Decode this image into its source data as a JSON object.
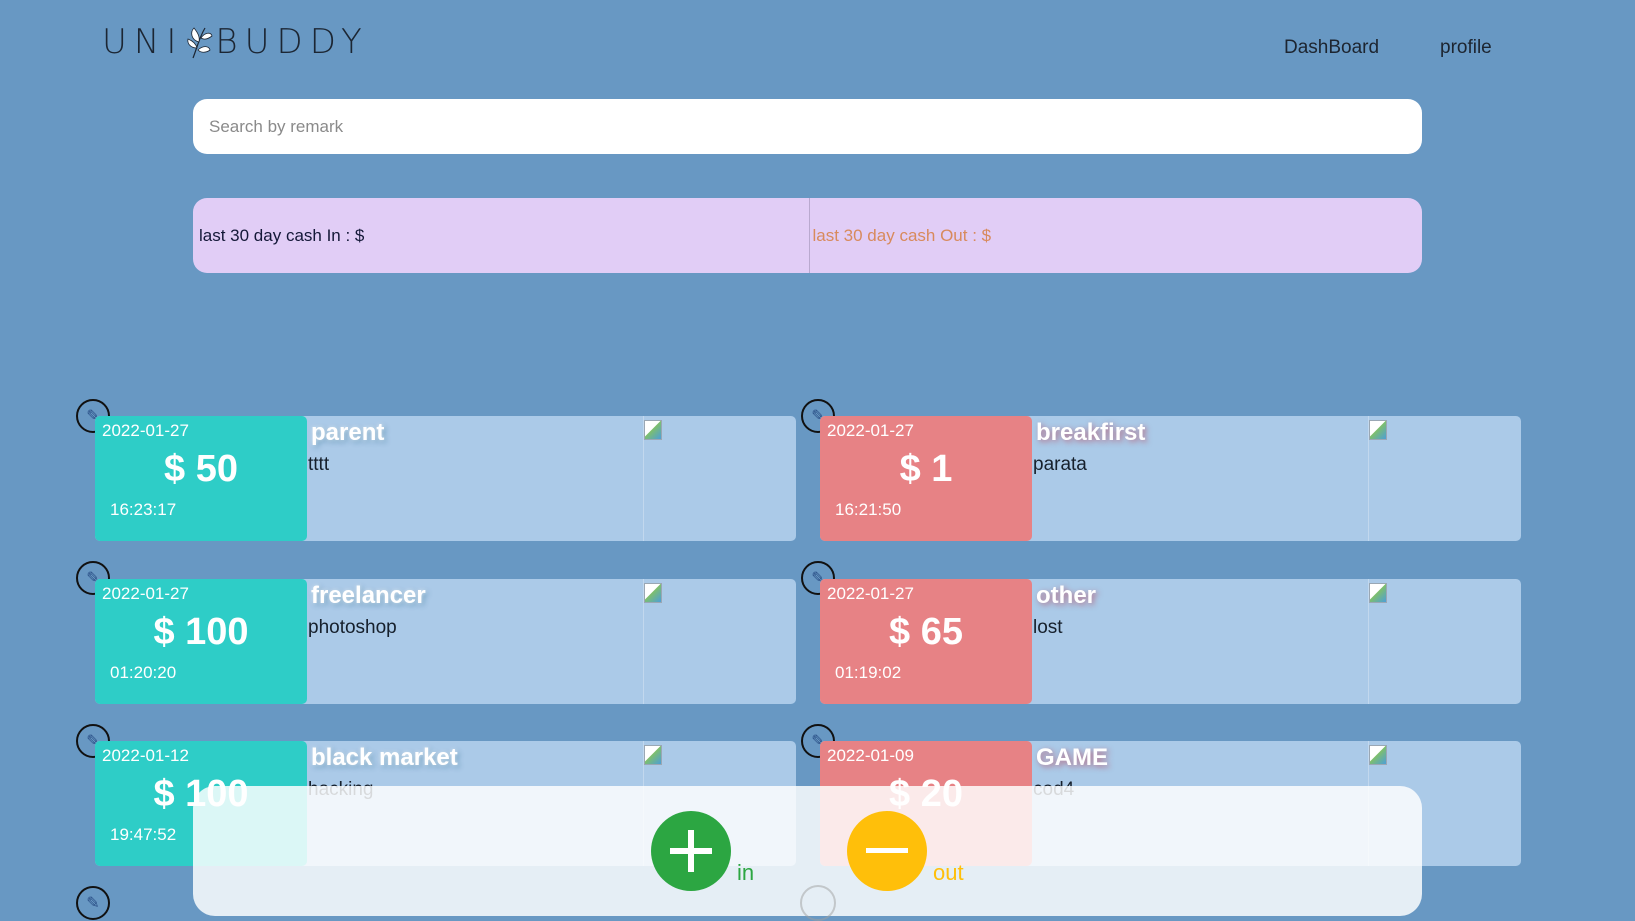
{
  "brand": {
    "left": "UNI",
    "right": "BUDDY"
  },
  "nav": {
    "dashboard": "DashBoard",
    "profile": "profile"
  },
  "search": {
    "placeholder": "Search by remark",
    "value": ""
  },
  "summary": {
    "cash_in_label": "last 30 day cash In : $",
    "cash_out_label": "last 30 day cash Out : $"
  },
  "entries": [
    {
      "type": "in",
      "date": "2022-01-27",
      "amount": "$ 50",
      "time": "16:23:17",
      "category": "parent",
      "remark": "tttt"
    },
    {
      "type": "out",
      "date": "2022-01-27",
      "amount": "$ 1",
      "time": "16:21:50",
      "category": "breakfirst",
      "remark": "parata"
    },
    {
      "type": "in",
      "date": "2022-01-27",
      "amount": "$ 100",
      "time": "01:20:20",
      "category": "freelancer",
      "remark": "photoshop"
    },
    {
      "type": "out",
      "date": "2022-01-27",
      "amount": "$ 65",
      "time": "01:19:02",
      "category": "other",
      "remark": "lost"
    },
    {
      "type": "in",
      "date": "2022-01-12",
      "amount": "$ 100",
      "time": "19:47:52",
      "category": "black market",
      "remark": "hacking"
    },
    {
      "type": "out",
      "date": "2022-01-09",
      "amount": "$ 20",
      "time": "",
      "category": "GAME",
      "remark": "cod4"
    }
  ],
  "actions": {
    "in_label": "in",
    "out_label": "out"
  },
  "colors": {
    "background": "#6898c3",
    "cash_in": "#2ecdc7",
    "cash_out": "#e78285",
    "add_button": "#2ca642",
    "remove_button": "#ffbf0a",
    "summary_bg": "#e1cdf6"
  },
  "icons": {
    "edit": "pencil-icon",
    "add": "plus-icon",
    "remove": "minus-icon",
    "logo": "leaf-icon",
    "image": "broken-image-icon"
  }
}
